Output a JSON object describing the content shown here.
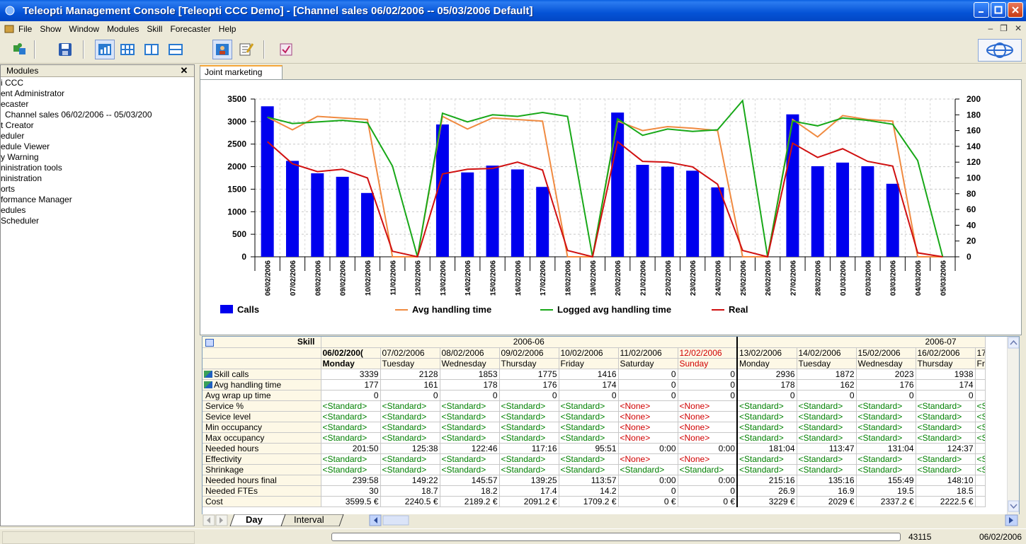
{
  "window": {
    "title": "Teleopti Management Console [Teleopti CCC Demo] - [Channel sales 06/02/2006 -- 05/03/2006 Default]"
  },
  "menu": [
    "File",
    "Show",
    "Window",
    "Modules",
    "Skill",
    "Forecaster",
    "Help"
  ],
  "left_panel": {
    "title": "Modules",
    "items": [
      "i CCC",
      "ent Administrator",
      "ecaster",
      "Channel sales 06/02/2006 -- 05/03/200",
      "t Creator",
      "eduler",
      "edule Viewer",
      "y Warning",
      "ninistration tools",
      "ninistration",
      "orts",
      "formance Manager",
      "edules",
      "Scheduler"
    ]
  },
  "tab_label": "Joint marketing",
  "chart_data": {
    "type": "bar",
    "x": [
      "06/02/2006",
      "07/02/2006",
      "08/02/2006",
      "09/02/2006",
      "10/02/2006",
      "11/02/2006",
      "12/02/2006",
      "13/02/2006",
      "14/02/2006",
      "15/02/2006",
      "16/02/2006",
      "17/02/2006",
      "18/02/2006",
      "19/02/2006",
      "20/02/2006",
      "21/02/2006",
      "22/02/2006",
      "23/02/2006",
      "24/02/2006",
      "25/02/2006",
      "26/02/2006",
      "27/02/2006",
      "28/02/2006",
      "01/03/2006",
      "02/03/2006",
      "03/03/2006",
      "04/03/2006",
      "05/03/2006"
    ],
    "series": [
      {
        "name": "Calls",
        "axis": "left",
        "kind": "bar",
        "color": "#0000ee",
        "values": [
          3339,
          2128,
          1853,
          1775,
          1416,
          0,
          0,
          2936,
          1872,
          2023,
          1938,
          1550,
          0,
          0,
          3200,
          2040,
          2000,
          1910,
          1540,
          0,
          0,
          3160,
          2010,
          2090,
          2010,
          1620,
          0,
          0
        ]
      },
      {
        "name": "Avg handling time",
        "axis": "right",
        "kind": "line",
        "color": "#f08a40",
        "values": [
          177,
          161,
          178,
          176,
          174,
          0,
          0,
          178,
          162,
          176,
          174,
          172,
          0,
          0,
          172,
          160,
          165,
          163,
          160,
          0,
          0,
          174,
          152,
          179,
          174,
          172,
          0,
          0
        ]
      },
      {
        "name": "Logged avg handling time",
        "axis": "right",
        "kind": "line",
        "color": "#18a818",
        "values": [
          177,
          169,
          171,
          173,
          170,
          115,
          0,
          182,
          171,
          180,
          178,
          183,
          178,
          0,
          175,
          154,
          162,
          159,
          161,
          198,
          0,
          172,
          166,
          176,
          173,
          168,
          122,
          0
        ]
      },
      {
        "name": "Real",
        "axis": "right",
        "kind": "line",
        "color": "#d01010",
        "values": [
          146,
          118,
          108,
          111,
          100,
          7,
          0,
          105,
          111,
          112,
          120,
          110,
          8,
          0,
          146,
          121,
          120,
          114,
          92,
          8,
          0,
          144,
          126,
          137,
          121,
          115,
          5,
          0
        ]
      }
    ],
    "y_left": {
      "min": 0,
      "max": 3500,
      "ticks": [
        0,
        500,
        1000,
        1500,
        2000,
        2500,
        3000,
        3500
      ]
    },
    "y_right": {
      "min": 0,
      "max": 200,
      "ticks": [
        0,
        20,
        40,
        60,
        80,
        100,
        120,
        140,
        160,
        180,
        200
      ]
    },
    "grid": true,
    "legend_position": "bottom"
  },
  "grid": {
    "corner_label": "Skill",
    "months": [
      "2006-06",
      "2006-07"
    ],
    "dates": [
      "06/02/200(",
      "07/02/2006",
      "08/02/2006",
      "09/02/2006",
      "10/02/2006",
      "11/02/2006",
      "12/02/2006",
      "13/02/2006",
      "14/02/2006",
      "15/02/2006",
      "16/02/2006",
      "17,"
    ],
    "days": [
      "Monday",
      "Tuesday",
      "Wednesday",
      "Thursday",
      "Friday",
      "Saturday",
      "Sunday",
      "Monday",
      "Tuesday",
      "Wednesday",
      "Thursday",
      "Fri"
    ],
    "rows": [
      {
        "label": "Skill calls",
        "icon": true,
        "type": "num",
        "cells": [
          "3339",
          "2128",
          "1853",
          "1775",
          "1416",
          "0",
          "0",
          "2936",
          "1872",
          "2023",
          "1938",
          ""
        ]
      },
      {
        "label": "Avg handling time",
        "icon": true,
        "type": "num",
        "cells": [
          "177",
          "161",
          "178",
          "176",
          "174",
          "0",
          "0",
          "178",
          "162",
          "176",
          "174",
          ""
        ]
      },
      {
        "label": "Avg wrap up time",
        "type": "num",
        "cells": [
          "0",
          "0",
          "0",
          "0",
          "0",
          "0",
          "0",
          "0",
          "0",
          "0",
          "0",
          ""
        ]
      },
      {
        "label": "Service %",
        "type": "std",
        "cells": [
          "<Standard>",
          "<Standard>",
          "<Standard>",
          "<Standard>",
          "<Standard>",
          "<None>",
          "<None>",
          "<Standard>",
          "<Standard>",
          "<Standard>",
          "<Standard>",
          "<S"
        ]
      },
      {
        "label": "Sevice level",
        "type": "std",
        "cells": [
          "<Standard>",
          "<Standard>",
          "<Standard>",
          "<Standard>",
          "<Standard>",
          "<None>",
          "<None>",
          "<Standard>",
          "<Standard>",
          "<Standard>",
          "<Standard>",
          "<S"
        ]
      },
      {
        "label": "Min occupancy",
        "type": "std",
        "cells": [
          "<Standard>",
          "<Standard>",
          "<Standard>",
          "<Standard>",
          "<Standard>",
          "<None>",
          "<None>",
          "<Standard>",
          "<Standard>",
          "<Standard>",
          "<Standard>",
          "<S"
        ]
      },
      {
        "label": "Max occupancy",
        "type": "std",
        "cells": [
          "<Standard>",
          "<Standard>",
          "<Standard>",
          "<Standard>",
          "<Standard>",
          "<None>",
          "<None>",
          "<Standard>",
          "<Standard>",
          "<Standard>",
          "<Standard>",
          "<S"
        ]
      },
      {
        "label": "Needed hours",
        "type": "num",
        "cells": [
          "201:50",
          "125:38",
          "122:46",
          "117:16",
          "95:51",
          "0:00",
          "0:00",
          "181:04",
          "113:47",
          "131:04",
          "124:37",
          ""
        ]
      },
      {
        "label": "Effectivity",
        "type": "std",
        "cells": [
          "<Standard>",
          "<Standard>",
          "<Standard>",
          "<Standard>",
          "<Standard>",
          "<None>",
          "<None>",
          "<Standard>",
          "<Standard>",
          "<Standard>",
          "<Standard>",
          "<S"
        ]
      },
      {
        "label": "Shrinkage",
        "type": "std",
        "cells": [
          "<Standard>",
          "<Standard>",
          "<Standard>",
          "<Standard>",
          "<Standard>",
          "<Standard>",
          "<Standard>",
          "<Standard>",
          "<Standard>",
          "<Standard>",
          "<Standard>",
          "<S"
        ]
      },
      {
        "label": "Needed hours final",
        "type": "num",
        "cells": [
          "239:58",
          "149:22",
          "145:57",
          "139:25",
          "113:57",
          "0:00",
          "0:00",
          "215:16",
          "135:16",
          "155:49",
          "148:10",
          ""
        ]
      },
      {
        "label": "Needed FTEs",
        "type": "num",
        "cells": [
          "30",
          "18.7",
          "18.2",
          "17.4",
          "14.2",
          "0",
          "0",
          "26.9",
          "16.9",
          "19.5",
          "18.5",
          ""
        ]
      },
      {
        "label": "Cost",
        "type": "num",
        "cells": [
          "3599.5 €",
          "2240.5 €",
          "2189.2 €",
          "2091.2 €",
          "1709.2 €",
          "0 €",
          "0 €",
          "3229 €",
          "2029 €",
          "2337.2 €",
          "2222.5 €",
          ""
        ]
      }
    ]
  },
  "sheet_tabs": [
    "Day",
    "Interval"
  ],
  "status": {
    "count": "43115",
    "date": "06/02/2006"
  },
  "colors": {
    "titlebar": "#0553d6",
    "bars": "#0000ee"
  }
}
